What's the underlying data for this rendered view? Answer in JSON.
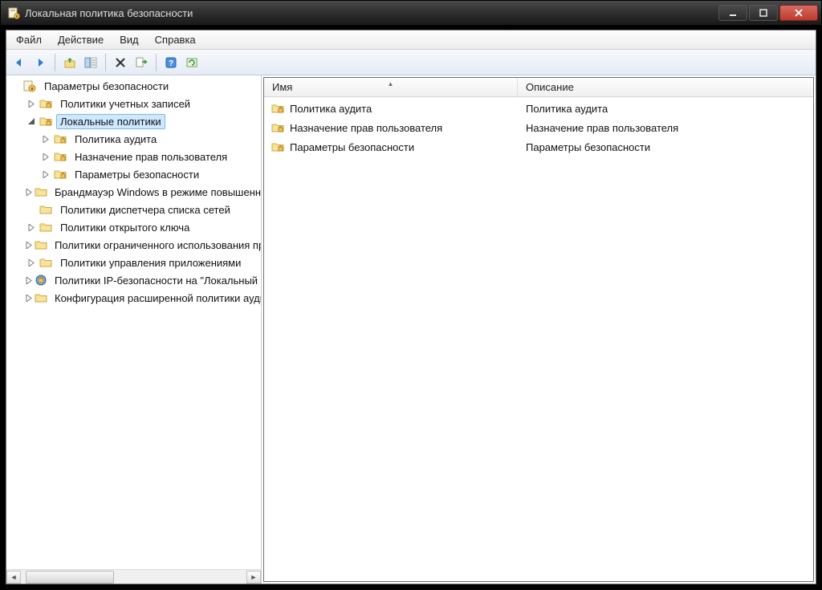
{
  "window": {
    "title": "Локальная политика безопасности"
  },
  "menu": {
    "file": "Файл",
    "action": "Действие",
    "view": "Вид",
    "help": "Справка"
  },
  "toolbar": {
    "back": "back",
    "forward": "forward",
    "up": "up",
    "show_hide_tree": "show-hide-tree",
    "delete": "delete",
    "export": "export",
    "help": "help",
    "refresh": "refresh"
  },
  "tree": {
    "root": "Параметры безопасности",
    "nodes": [
      {
        "label": "Политики учетных записей",
        "expanded": false,
        "depth": 1,
        "hasChildren": true,
        "icon": "folder-lock"
      },
      {
        "label": "Локальные политики",
        "expanded": true,
        "depth": 1,
        "hasChildren": true,
        "selected": true,
        "icon": "folder-lock"
      },
      {
        "label": "Политика аудита",
        "expanded": false,
        "depth": 2,
        "hasChildren": true,
        "icon": "folder-lock"
      },
      {
        "label": "Назначение прав пользователя",
        "expanded": false,
        "depth": 2,
        "hasChildren": true,
        "icon": "folder-lock"
      },
      {
        "label": "Параметры безопасности",
        "expanded": false,
        "depth": 2,
        "hasChildren": true,
        "icon": "folder-lock"
      },
      {
        "label": "Брандмауэр Windows в режиме повышенной безопасности",
        "expanded": false,
        "depth": 1,
        "hasChildren": true,
        "icon": "folder"
      },
      {
        "label": "Политики диспетчера списка сетей",
        "expanded": false,
        "depth": 1,
        "hasChildren": false,
        "icon": "folder"
      },
      {
        "label": "Политики открытого ключа",
        "expanded": false,
        "depth": 1,
        "hasChildren": true,
        "icon": "folder"
      },
      {
        "label": "Политики ограниченного использования программ",
        "expanded": false,
        "depth": 1,
        "hasChildren": true,
        "icon": "folder"
      },
      {
        "label": "Политики управления приложениями",
        "expanded": false,
        "depth": 1,
        "hasChildren": true,
        "icon": "folder"
      },
      {
        "label": "Политики IP-безопасности на \"Локальный компьютер\"",
        "expanded": false,
        "depth": 1,
        "hasChildren": true,
        "icon": "ipsec"
      },
      {
        "label": "Конфигурация расширенной политики аудита",
        "expanded": false,
        "depth": 1,
        "hasChildren": true,
        "icon": "folder"
      }
    ]
  },
  "list": {
    "columns": {
      "name": "Имя",
      "description": "Описание"
    },
    "rows": [
      {
        "name": "Политика аудита",
        "description": "Политика аудита"
      },
      {
        "name": "Назначение прав пользователя",
        "description": "Назначение прав пользователя"
      },
      {
        "name": "Параметры безопасности",
        "description": "Параметры безопасности"
      }
    ]
  }
}
